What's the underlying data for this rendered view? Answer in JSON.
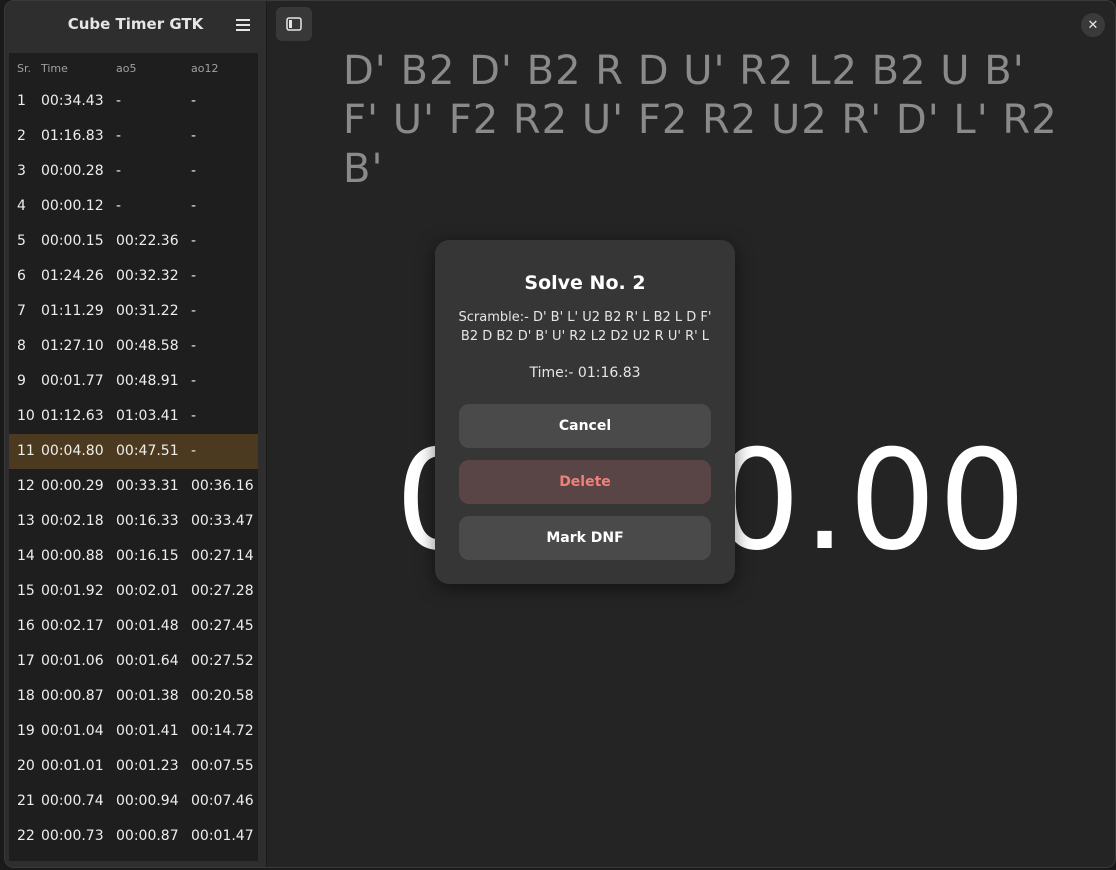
{
  "app": {
    "title": "Cube Timer GTK"
  },
  "list": {
    "headers": {
      "sr": "Sr.",
      "time": "Time",
      "ao5": "ao5",
      "ao12": "ao12"
    },
    "selected_index": 11,
    "rows": [
      {
        "sr": "1",
        "time": "00:34.43",
        "ao5": "-",
        "ao12": "-"
      },
      {
        "sr": "2",
        "time": "01:16.83",
        "ao5": "-",
        "ao12": "-"
      },
      {
        "sr": "3",
        "time": "00:00.28",
        "ao5": "-",
        "ao12": "-"
      },
      {
        "sr": "4",
        "time": "00:00.12",
        "ao5": "-",
        "ao12": "-"
      },
      {
        "sr": "5",
        "time": "00:00.15",
        "ao5": "00:22.36",
        "ao12": "-"
      },
      {
        "sr": "6",
        "time": "01:24.26",
        "ao5": "00:32.32",
        "ao12": "-"
      },
      {
        "sr": "7",
        "time": "01:11.29",
        "ao5": "00:31.22",
        "ao12": "-"
      },
      {
        "sr": "8",
        "time": "01:27.10",
        "ao5": "00:48.58",
        "ao12": "-"
      },
      {
        "sr": "9",
        "time": "00:01.77",
        "ao5": "00:48.91",
        "ao12": "-"
      },
      {
        "sr": "10",
        "time": "01:12.63",
        "ao5": "01:03.41",
        "ao12": "-"
      },
      {
        "sr": "11",
        "time": "00:04.80",
        "ao5": "00:47.51",
        "ao12": "-"
      },
      {
        "sr": "12",
        "time": "00:00.29",
        "ao5": "00:33.31",
        "ao12": "00:36.16"
      },
      {
        "sr": "13",
        "time": "00:02.18",
        "ao5": "00:16.33",
        "ao12": "00:33.47"
      },
      {
        "sr": "14",
        "time": "00:00.88",
        "ao5": "00:16.15",
        "ao12": "00:27.14"
      },
      {
        "sr": "15",
        "time": "00:01.92",
        "ao5": "00:02.01",
        "ao12": "00:27.28"
      },
      {
        "sr": "16",
        "time": "00:02.17",
        "ao5": "00:01.48",
        "ao12": "00:27.45"
      },
      {
        "sr": "17",
        "time": "00:01.06",
        "ao5": "00:01.64",
        "ao12": "00:27.52"
      },
      {
        "sr": "18",
        "time": "00:00.87",
        "ao5": "00:01.38",
        "ao12": "00:20.58"
      },
      {
        "sr": "19",
        "time": "00:01.04",
        "ao5": "00:01.41",
        "ao12": "00:14.72"
      },
      {
        "sr": "20",
        "time": "00:01.01",
        "ao5": "00:01.23",
        "ao12": "00:07.55"
      },
      {
        "sr": "21",
        "time": "00:00.74",
        "ao5": "00:00.94",
        "ao12": "00:07.46"
      },
      {
        "sr": "22",
        "time": "00:00.73",
        "ao5": "00:00.87",
        "ao12": "00:01.47"
      }
    ]
  },
  "main": {
    "scramble": "D' B2 D' B2 R D U' R2 L2 B2 U B' F' U' F2 R2 U' F2 R2 U2 R' D' L' R2 B'",
    "timer": "00:00.00"
  },
  "dialog": {
    "title": "Solve No. 2",
    "scramble": "Scramble:- D' B' L' U2 B2 R' L B2 L D F' B2 D B2 D' B' U' R2 L2 D2 U2 R U' R' L",
    "time": "Time:- 01:16.83",
    "cancel_label": "Cancel",
    "delete_label": "Delete",
    "dnf_label": "Mark DNF"
  },
  "icons": {
    "menu": "hamburger-menu-icon",
    "sidebar_toggle": "sidebar-toggle-icon",
    "close": "close-icon"
  },
  "colors": {
    "selected_row": "#4b3a1f",
    "delete_text": "#f0807a",
    "delete_bg": "#5a4546"
  }
}
